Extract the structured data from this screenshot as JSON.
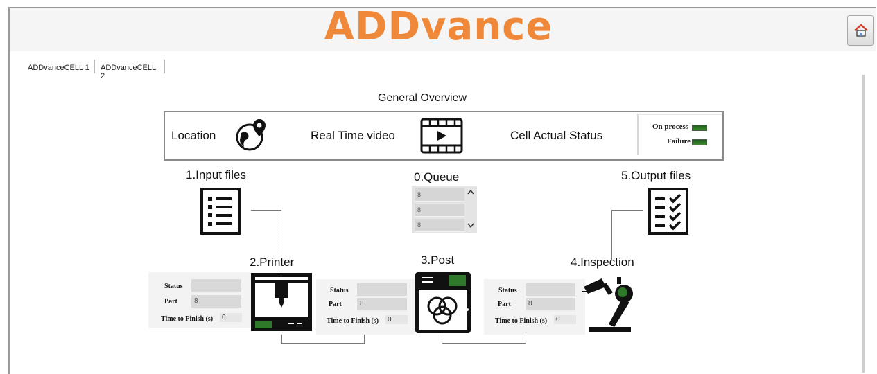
{
  "app": {
    "title": "ADDvance"
  },
  "header": {
    "home_icon": "home-icon"
  },
  "tabs": [
    {
      "label": "ADDvanceCELL 1"
    },
    {
      "label": "ADDvanceCELL 2"
    }
  ],
  "overview": {
    "title": "General Overview",
    "location_label": "Location",
    "video_label": "Real Time video",
    "cell_status_label": "Cell Actual Status",
    "indicators": [
      {
        "label": "On process",
        "color": "#2f7a2a"
      },
      {
        "label": "Failure",
        "color": "#2f7a2a"
      }
    ]
  },
  "stages": {
    "input": {
      "title": "1.Input files"
    },
    "queue": {
      "title": "0.Queue",
      "rows": [
        "8",
        "8",
        "8"
      ]
    },
    "output": {
      "title": "5.Output files"
    },
    "printer": {
      "title": "2.Printer",
      "status_label": "Status",
      "status_value": "",
      "part_label": "Part",
      "part_value": "8",
      "time_label": "Time to Finish (s)",
      "time_value": "0"
    },
    "post": {
      "title": "3.Post",
      "status_label": "Status",
      "status_value": "",
      "part_label": "Part",
      "part_value": "8",
      "time_label": "Time to Finish (s)",
      "time_value": "0"
    },
    "inspection": {
      "title": "4.Inspection",
      "status_label": "Status",
      "status_value": "",
      "part_label": "Part",
      "part_value": "8",
      "time_label": "Time to Finish (s)",
      "time_value": "0"
    }
  }
}
